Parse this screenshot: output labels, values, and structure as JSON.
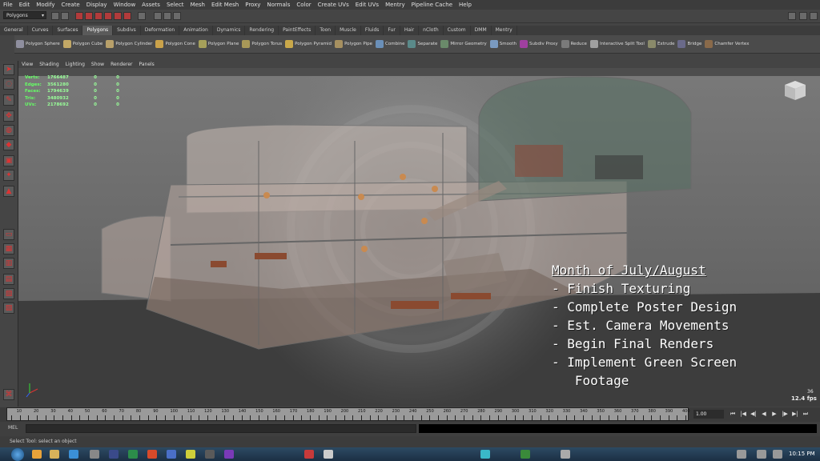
{
  "menu": [
    "File",
    "Edit",
    "Modify",
    "Create",
    "Display",
    "Window",
    "Assets",
    "Select",
    "Mesh",
    "Edit Mesh",
    "Proxy",
    "Normals",
    "Color",
    "Create UVs",
    "Edit UVs",
    "Mentry",
    "Pipeline Cache",
    "Help"
  ],
  "status_line": {
    "mode": "Polygons"
  },
  "shelf_tabs": [
    "General",
    "Curves",
    "Surfaces",
    "Polygons",
    "Subdivs",
    "Deformation",
    "Animation",
    "Dynamics",
    "Rendering",
    "PaintEffects",
    "Toon",
    "Muscle",
    "Fluids",
    "Fur",
    "Hair",
    "nCloth",
    "Custom",
    "DMM",
    "Mentry"
  ],
  "active_shelf_tab": "Polygons",
  "shelf_tools": [
    "Polygon Sphere",
    "Polygon Cube",
    "Polygon Cylinder",
    "Polygon Cone",
    "Polygon Plane",
    "Polygon Torus",
    "Polygon Pyramid",
    "Polygon Pipe",
    "Combine",
    "Separate",
    "Mirror Geometry",
    "Smooth",
    "Subdiv Proxy",
    "Reduce",
    "Interactive Split Tool",
    "Extrude",
    "Bridge",
    "Chamfer Vertex"
  ],
  "panel_menu": [
    "View",
    "Shading",
    "Lighting",
    "Show",
    "Renderer",
    "Panels"
  ],
  "hud": [
    {
      "label": "Verts:",
      "value": "1766487",
      "a": "0",
      "b": "0"
    },
    {
      "label": "Edges:",
      "value": "3561280",
      "a": "0",
      "b": "0"
    },
    {
      "label": "Faces:",
      "value": "1794639",
      "a": "0",
      "b": "0"
    },
    {
      "label": "Tris:",
      "value": "3480932",
      "a": "0",
      "b": "0"
    },
    {
      "label": "UVs:",
      "value": "2178692",
      "a": "0",
      "b": "0"
    }
  ],
  "viewcube_label": "FRONT RIGHT",
  "notes": {
    "title": "Month of July/August",
    "items": [
      "- Finish Texturing",
      "- Complete Poster Design",
      "- Est. Camera Movements",
      "- Begin Final Renders",
      "- Implement Green Screen",
      "   Footage"
    ]
  },
  "fps_frame": "36",
  "fps": "12.4 fps",
  "timeline": {
    "ticks": [
      "5",
      "10",
      "15",
      "20",
      "25",
      "30",
      "35",
      "40",
      "45",
      "50",
      "55",
      "60",
      "65",
      "70",
      "75",
      "80",
      "85",
      "90",
      "95",
      "100",
      "105",
      "110",
      "115",
      "120",
      "125",
      "130",
      "135",
      "140",
      "145",
      "150",
      "155",
      "160",
      "165",
      "170",
      "175",
      "180",
      "185",
      "190",
      "195",
      "200",
      "205",
      "210",
      "215",
      "220",
      "225",
      "230",
      "235",
      "240",
      "245",
      "250",
      "255",
      "260",
      "265",
      "270",
      "275",
      "280",
      "285",
      "290",
      "295",
      "300",
      "305",
      "310",
      "315",
      "320",
      "325",
      "330",
      "335",
      "340",
      "345",
      "350",
      "355",
      "360",
      "365",
      "370",
      "375",
      "380",
      "385",
      "390",
      "395",
      "400"
    ],
    "current_frame": "1.00"
  },
  "playback": [
    "⏮",
    "|◀",
    "◀|",
    "◀",
    "▶",
    "|▶",
    "▶|",
    "⏭"
  ],
  "cmd_label": "MEL",
  "help_line": "Select Tool: select an object",
  "clock": "10:15 PM",
  "colors": {
    "accent": "#3a76b3",
    "hud_text": "#66ff66",
    "red_icon": "#b23b3b"
  }
}
